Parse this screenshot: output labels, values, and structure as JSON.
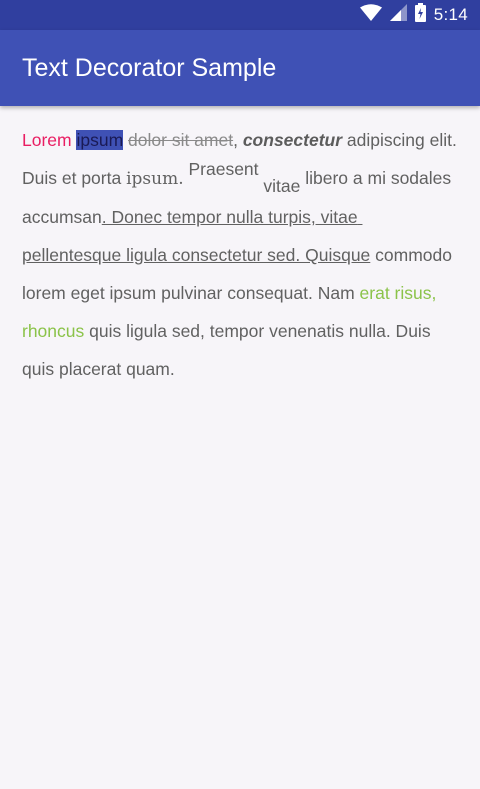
{
  "status_bar": {
    "time": "5:14"
  },
  "app_bar": {
    "title": "Text Decorator Sample"
  },
  "paragraph": [
    {
      "text": "Lorem",
      "style": "pink"
    },
    {
      "text": " ",
      "style": ""
    },
    {
      "text": "ipsum",
      "style": "hl"
    },
    {
      "text": " ",
      "style": ""
    },
    {
      "text": "dolor sit amet",
      "style": "strike"
    },
    {
      "text": ", ",
      "style": ""
    },
    {
      "text": "consectetur",
      "style": "bi"
    },
    {
      "text": " adipiscing elit. Duis et porta ",
      "style": ""
    },
    {
      "text": "ipsum.",
      "style": "serif"
    },
    {
      "text": " ",
      "style": ""
    },
    {
      "text": "Praesent",
      "style": "sup"
    },
    {
      "text": " ",
      "style": ""
    },
    {
      "text": "vitae",
      "style": "sub"
    },
    {
      "text": " libero a mi sodales accumsan",
      "style": ""
    },
    {
      "text": ". Donec tempor nulla turpis, vitae pellentesque ligula consectetur sed. Quisque",
      "style": "under"
    },
    {
      "text": " commodo lorem eget ipsum pulvinar consequat. Nam ",
      "style": ""
    },
    {
      "text": "erat risus, rhoncus",
      "style": "green"
    },
    {
      "text": " quis ligula sed, tempor venenatis nulla. Duis quis placerat quam.",
      "style": ""
    }
  ]
}
